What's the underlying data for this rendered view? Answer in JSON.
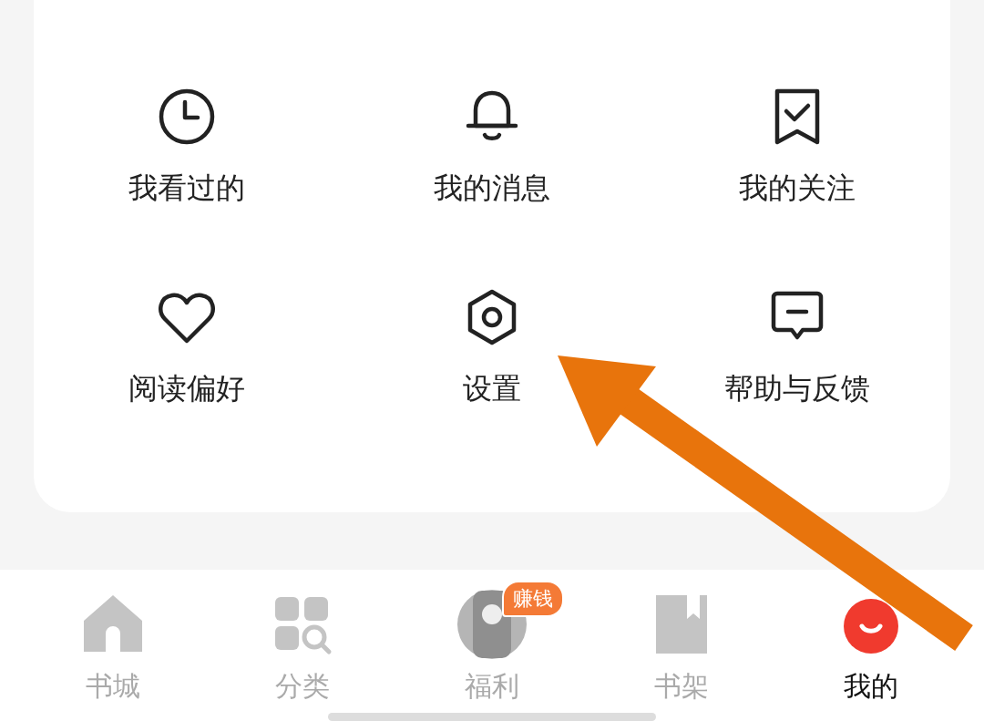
{
  "functions": [
    {
      "label": "我看过的"
    },
    {
      "label": "我的消息"
    },
    {
      "label": "我的关注"
    },
    {
      "label": "阅读偏好"
    },
    {
      "label": "设置"
    },
    {
      "label": "帮助与反馈"
    }
  ],
  "tab_bar": [
    {
      "label": "书城",
      "selected": false
    },
    {
      "label": "分类",
      "selected": false
    },
    {
      "label": "福利",
      "selected": false,
      "badge": "赚钱"
    },
    {
      "label": "书架",
      "selected": false
    },
    {
      "label": "我的",
      "selected": true
    }
  ]
}
